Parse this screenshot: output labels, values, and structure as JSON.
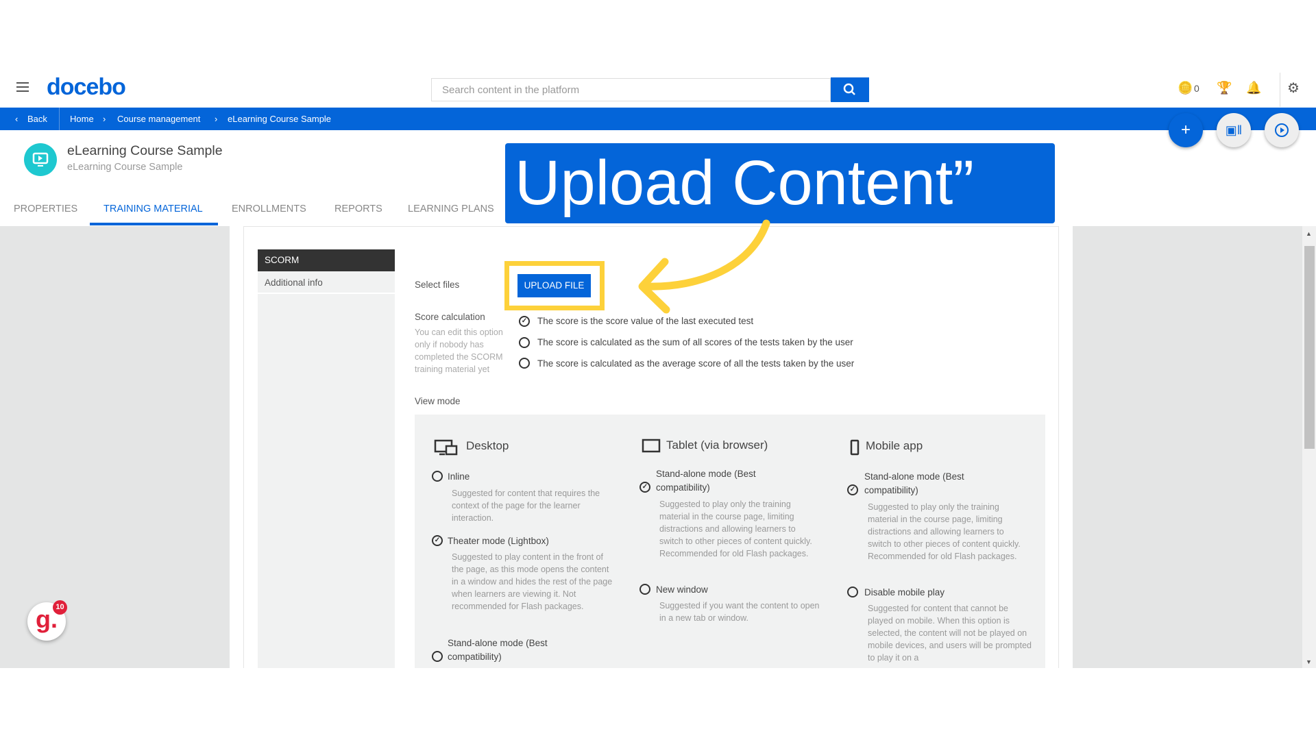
{
  "header": {
    "logo": "docebo",
    "search_placeholder": "Search content in the platform",
    "coins_count": "0",
    "icons": [
      "menu-icon",
      "search-icon",
      "coins-icon",
      "trophy-icon",
      "bell-icon",
      "gear-icon"
    ]
  },
  "breadcrumb": {
    "back": "Back",
    "items": [
      "Home",
      "Course management",
      "eLearning Course Sample"
    ]
  },
  "fabs": [
    "plus-icon",
    "catalog-icon",
    "play-icon"
  ],
  "course": {
    "title": "eLearning Course Sample",
    "subtitle": "eLearning Course Sample"
  },
  "tabs": [
    {
      "label": "PROPERTIES"
    },
    {
      "label": "TRAINING MATERIAL",
      "active": true
    },
    {
      "label": "ENROLLMENTS"
    },
    {
      "label": "REPORTS"
    },
    {
      "label": "LEARNING PLANS"
    }
  ],
  "sidebar": {
    "items": [
      "SCORM",
      "Additional info"
    ]
  },
  "form": {
    "select_files": "Select files",
    "upload_button": "UPLOAD FILE",
    "score_label": "Score calculation",
    "score_help": "You can edit this option only if nobody has completed the SCORM training material yet",
    "score_options": [
      {
        "label": "The score is the score value of the last executed test",
        "selected": true
      },
      {
        "label": "The score is calculated as the sum of all scores of the tests taken by the user",
        "selected": false
      },
      {
        "label": "The score is calculated as the average score of all the tests taken by the user",
        "selected": false
      }
    ],
    "view_mode": "View mode"
  },
  "view_modes": {
    "desktop": {
      "title": "Desktop",
      "options": [
        {
          "label": "Inline",
          "desc": "Suggested for content that requires the context of the page for the learner interaction.",
          "selected": false
        },
        {
          "label": "Theater mode (Lightbox)",
          "desc": "Suggested to play content in the front of the page, as this mode opens the content in a window and hides the rest of the page when learners are viewing it. Not recommended for Flash packages.",
          "selected": true
        },
        {
          "label": "Stand-alone mode (Best compatibility)",
          "selected": false
        }
      ]
    },
    "tablet": {
      "title": "Tablet (via browser)",
      "options": [
        {
          "label": "Stand-alone mode (Best compatibility)",
          "desc": "Suggested to play only the training material in the course page, limiting distractions and allowing learners to switch to other pieces of content quickly. Recommended for old Flash packages.",
          "selected": true
        },
        {
          "label": "New window",
          "desc": "Suggested if you want the content to open in a new tab or window.",
          "selected": false
        }
      ]
    },
    "mobile": {
      "title": "Mobile app",
      "options": [
        {
          "label": "Stand-alone mode (Best compatibility)",
          "desc": "Suggested to play only the training material in the course page, limiting distractions and allowing learners to switch to other pieces of content quickly. Recommended for old Flash packages.",
          "selected": true
        },
        {
          "label": "Disable mobile play",
          "desc": "Suggested for content that cannot be played on mobile. When this option is selected, the content will not be played on mobile devices, and users will be prompted to play it on a",
          "selected": false
        }
      ]
    }
  },
  "callout": {
    "text": "Upload Content”"
  },
  "widget": {
    "logo": "g.",
    "badge": "10"
  },
  "colors": {
    "brand": "#0465d9",
    "highlight": "#fdd13a",
    "teal": "#1ec8d0"
  }
}
